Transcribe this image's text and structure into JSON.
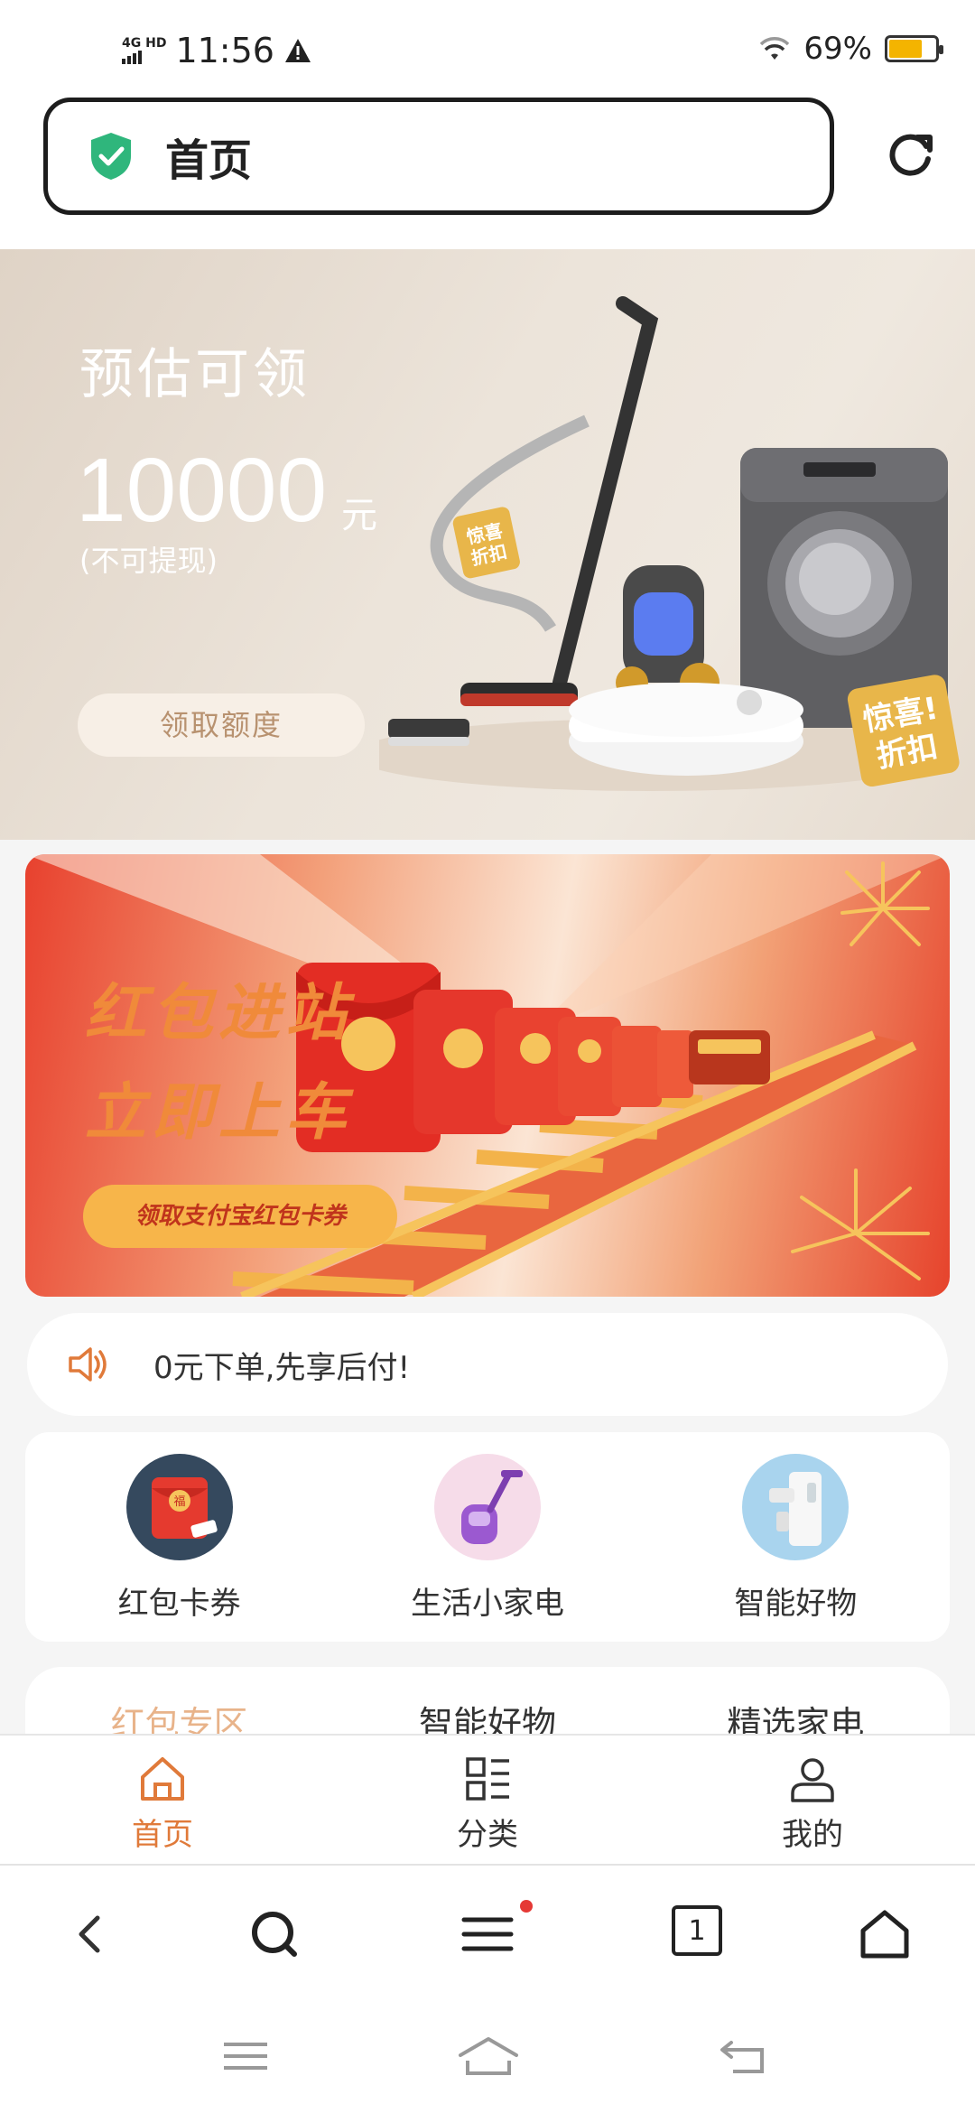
{
  "status_bar": {
    "network": "4G HD",
    "time": "11:56",
    "battery_percent": "69%",
    "battery_level": 0.69
  },
  "address_bar": {
    "title": "首页"
  },
  "hero": {
    "title": "预估可领",
    "amount": "10000",
    "unit": "元",
    "note": "(不可提现)",
    "button": "领取额度"
  },
  "promo": {
    "line1": "红包进站",
    "line2": "立即上车",
    "button": "领取支付宝红包卡券"
  },
  "notice": {
    "text": "0元下单,先享后付!"
  },
  "categories": [
    {
      "label": "红包卡券",
      "icon": "red-envelope-icon"
    },
    {
      "label": "生活小家电",
      "icon": "vacuum-icon"
    },
    {
      "label": "智能好物",
      "icon": "water-dispenser-icon"
    }
  ],
  "tabs": [
    {
      "label": "红包专区",
      "active": true
    },
    {
      "label": "智能好物",
      "active": false
    },
    {
      "label": "精选家电",
      "active": false
    }
  ],
  "app_nav": [
    {
      "label": "首页",
      "icon": "home-icon",
      "active": true
    },
    {
      "label": "分类",
      "icon": "category-icon",
      "active": false
    },
    {
      "label": "我的",
      "icon": "user-icon",
      "active": false
    }
  ],
  "browser_bar": {
    "tab_count": "1"
  },
  "colors": {
    "accent": "#e07a3a",
    "promo_red": "#e8412e",
    "battery": "#f4b400"
  }
}
